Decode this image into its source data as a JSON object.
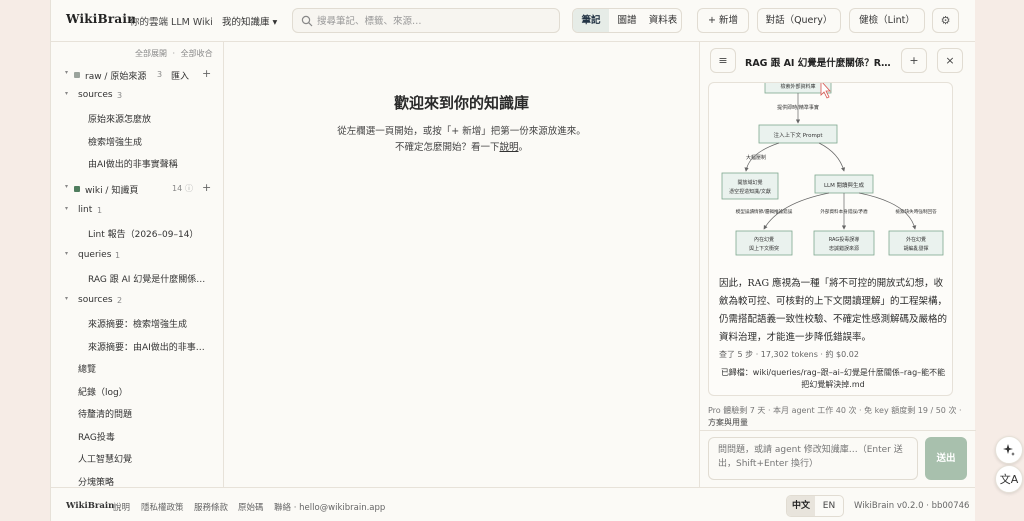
{
  "header": {
    "logo": "WikiBrain",
    "tagline": "你的雲端 LLM Wiki",
    "kb_selector": "我的知識庫 ▾",
    "search_placeholder": "搜尋筆記、標籤、來源…",
    "tabs": [
      {
        "label": "筆記",
        "active": true
      },
      {
        "label": "圖譜",
        "active": false
      },
      {
        "label": "資料表",
        "active": false
      }
    ],
    "new_button": "+ 新增",
    "query_button": "對話（Query）",
    "lint_button": "健檢（Lint）",
    "settings_icon": "gear-icon"
  },
  "sidebar": {
    "expand_all": "全部展開",
    "separator": "·",
    "collapse_all": "全部收合",
    "raw_section": {
      "label": "raw / 原始來源",
      "count": "3",
      "action": "匯入",
      "add": "+",
      "color": "#9aa39c"
    },
    "raw_sources_folder": {
      "label": "sources",
      "count": "3"
    },
    "raw_items": [
      "原始來源怎麼放",
      "檢索增強生成",
      "由AI做出的非事實聲稱"
    ],
    "wiki_section": {
      "label": "wiki / 知識頁",
      "count": "14",
      "info": "ⓘ",
      "add": "+",
      "color": "#4f7d5e"
    },
    "lint_folder": {
      "label": "lint",
      "count": "1"
    },
    "lint_items": [
      "Lint 報告（2026–09–14）"
    ],
    "queries_folder": {
      "label": "queries",
      "count": "1"
    },
    "queries_items": [
      "RAG 跟 AI 幻覺是什麼關係…"
    ],
    "sources_folder": {
      "label": "sources",
      "count": "2"
    },
    "sources_items": [
      "來源摘要：檢索增強生成",
      "來源摘要：由AI做出的非事…"
    ],
    "pages": [
      "總覽",
      "紀錄（log）",
      "待釐清的問題",
      "RAG投毒",
      "人工智慧幻覺",
      "分塊策略"
    ]
  },
  "main": {
    "title": "歡迎來到你的知識庫",
    "line1": "從左欄選一頁開始，或按「+ 新增」把第一份來源放進來。",
    "line2_prefix": "不確定怎麼開始？看一下",
    "line2_link": "說明",
    "line2_suffix": "。"
  },
  "panel": {
    "menu_icon": "hamburger-icon",
    "title": "RAG 跟 AI 幻覺是什麼關係？RA…",
    "add": "+",
    "close": "×",
    "diagram": {
      "top_box": "檢索外部資料庫",
      "edge1": "提供即時/精準事實",
      "mid_box": "注入上下文 Prompt",
      "edge2": "大幅壓制",
      "left_box_l1": "開放域幻覺",
      "left_box_l2": "憑空捏造知識/文獻",
      "right_box": "LLM 閱讀與生成",
      "edge_a": "模型誤讀情節/邏輯推論錯誤",
      "edge_b": "外部資料本身錯誤/矛盾",
      "edge_c": "檢索缺失時強制回答",
      "out1_l1": "內在幻覺",
      "out1_l2": "與上下文衝突",
      "out2_l1": "RAG投毒誤導",
      "out2_l2": "忠誠錯誤來源",
      "out3_l1": "外在幻覺",
      "out3_l2": "胡編亂發揮"
    },
    "answer": "因此，RAG 應視為一種「將不可控的開放式幻想，收斂為較可控、可核對的上下文閱讀理解」的工程架構，仍需搭配語義一致性校驗、不確定性感測解碼及嚴格的資料治理，才能進一步降低錯誤率。",
    "meta": "查了 5 步 · 17,302 tokens · 約 $0.02",
    "saved": "已歸檔：wiki/queries/rag–跟–ai–幻覺是什麼關係–rag–能不能把幻覺解決掉.md",
    "usage": "Pro 體驗剩 7 天 · 本月 agent 工作 40 次 · 免 key 額度剩 19 / 50 次 · ",
    "usage_link": "方案與用量",
    "chat_placeholder": "問問題，或請 agent 修改知識庫…（Enter 送出，Shift+Enter 換行）",
    "send": "送出"
  },
  "footer": {
    "logo": "WikiBrain",
    "links": [
      "說明",
      "隱私權政策",
      "服務條款",
      "原始碼"
    ],
    "contact": "聯絡 · hello@wikibrain.app",
    "lang": [
      {
        "label": "中文",
        "active": true
      },
      {
        "label": "EN",
        "active": false
      }
    ],
    "version": "WikiBrain v0.2.0 · bb00746"
  },
  "floating": {
    "sparkle_icon": "sparkle-icon",
    "translate_icon": "translate-icon"
  },
  "colors": {
    "accent": "#4f7d5e",
    "send_button": "#a8c0ad",
    "background": "#f6ece6"
  }
}
